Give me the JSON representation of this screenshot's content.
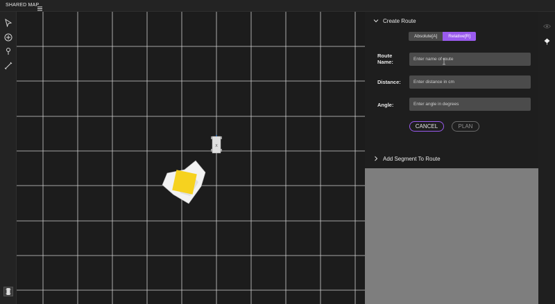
{
  "header": {
    "title": "SHARED MAP",
    "menu_icon": "hamburger-menu-icon"
  },
  "toolbar": {
    "tools": [
      {
        "name": "select",
        "icon": "pointer-arrow-icon"
      },
      {
        "name": "add",
        "icon": "plus-circle-icon"
      },
      {
        "name": "pin",
        "icon": "location-pin-icon"
      },
      {
        "name": "measure",
        "icon": "ruler-line-icon"
      }
    ],
    "robot_status_icon": "robot-icon"
  },
  "map": {
    "robot_label": "X",
    "target_color": "#f6d21f",
    "grid_color": "#e6e6e6"
  },
  "create_route": {
    "title": "Create Route",
    "mode_absolute": "Absolute[A]",
    "mode_relative": "Relative[R]",
    "selected_mode": "Relative[R]",
    "route_name_label_1": "Route",
    "route_name_label_2": "Name:",
    "route_name_placeholder": "Enter name of route",
    "distance_label": "Distance:",
    "distance_placeholder": "Enter distance in cm",
    "angle_label": "Angle:",
    "angle_placeholder": "Enter angle in degrees",
    "cancel_label": "CANCEL",
    "plan_label": "PLAN",
    "accent_color": "#9a5bef"
  },
  "add_segment": {
    "title": "Add Segment To Route"
  },
  "right_sidebar": {
    "visibility_icon": "eye-icon",
    "marker_icon": "diamond-marker-icon"
  }
}
